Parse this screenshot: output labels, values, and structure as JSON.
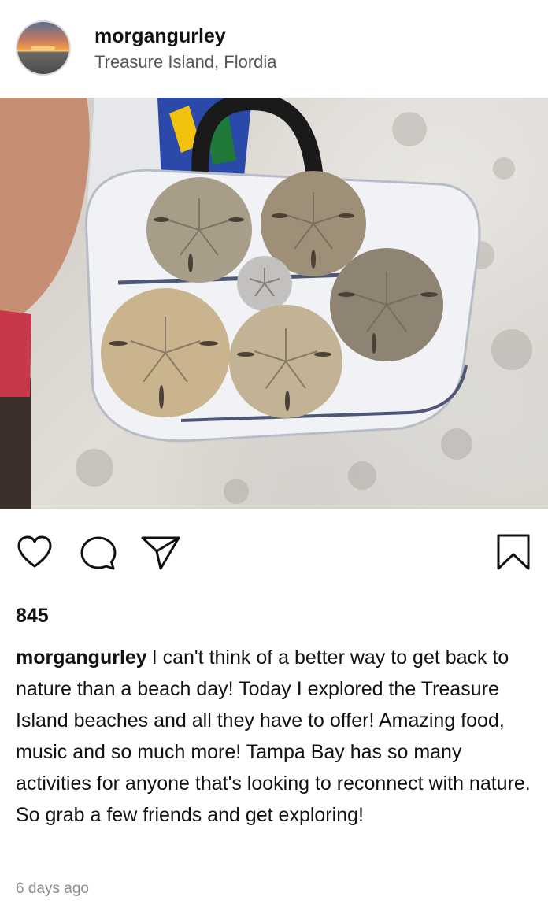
{
  "header": {
    "username": "morgangurley",
    "location": "Treasure Island, Flordia",
    "avatar_icon": "sunset-avatar"
  },
  "photo": {
    "content_icon": "sand-dollars-on-bag-photo"
  },
  "actions": {
    "like_icon": "heart-icon",
    "comment_icon": "comment-icon",
    "share_icon": "paper-plane-icon",
    "save_icon": "bookmark-icon"
  },
  "likes": {
    "count": "845"
  },
  "caption": {
    "username": "morgangurley",
    "text": "I can't think of a better way to get back to nature than a beach day! Today I explored the Treasure Island beaches and all they have to offer! Amazing food, music and so much more! Tampa Bay has so many activities for anyone that's looking to reconnect with nature. So grab a few friends and get exploring!"
  },
  "timestamp": "6 days ago",
  "colors": {
    "text": "#111111",
    "secondary_text": "#555555",
    "timestamp": "#8e8e8e"
  }
}
